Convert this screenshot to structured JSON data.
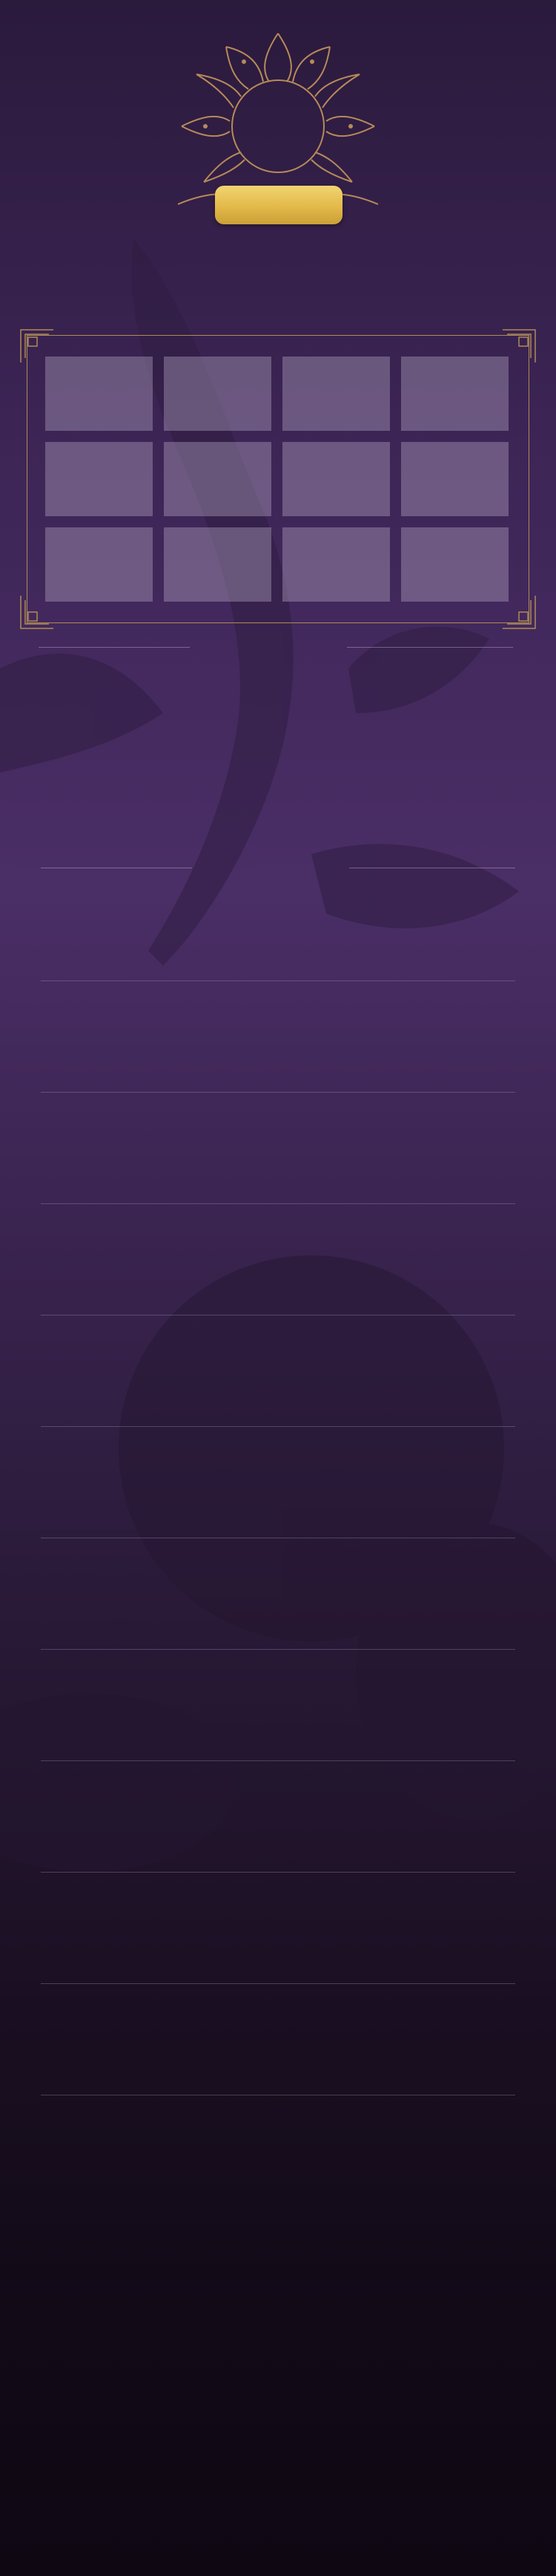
{
  "emblem": {
    "icon": "lotus-ornament-icon",
    "badge_label": "",
    "colors": {
      "outline": "#b88a5a",
      "badge": "#e6bd4d"
    }
  },
  "gallery": {
    "rows": 3,
    "columns": 4,
    "tiles": [
      "",
      "",
      "",
      "",
      "",
      "",
      "",
      "",
      "",
      "",
      "",
      ""
    ],
    "frame_color": "#b08a57"
  },
  "list": {
    "header_left": "",
    "header_right": "",
    "rows": [
      "",
      "",
      "",
      "",
      "",
      "",
      "",
      "",
      "",
      "",
      ""
    ]
  },
  "theme": {
    "background_top": "#2a1a3c",
    "background_mid": "#4a2e66",
    "background_bottom": "#0f0813"
  }
}
